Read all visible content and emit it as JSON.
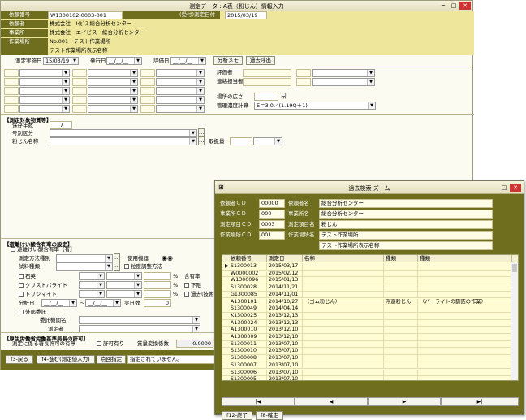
{
  "main": {
    "title": "測定データ : A表（粉じん）情報入力",
    "header": {
      "client_label": "依頼番号",
      "client_no": "W1300102-0003-001",
      "date_label": "(受付)測定日付",
      "date_value": "2015/03/19",
      "requester_label": "依頼者",
      "requester_value": "株式会社　Iｲﾋﾞｽ 総合分析センター",
      "office_label": "事業所",
      "office_value": "株式会社　エイビス　総合分析センター",
      "workplace_label": "作業場所",
      "workplace_value": "No.001　テスト作業場所",
      "workplace_display": "テスト作業場所表示名称"
    },
    "toolbar": {
      "implementation_date_label": "測定実施日",
      "implementation_date": "15/03/19",
      "issue_date_label": "発行日",
      "issue_date": "__/__/__",
      "eval_date_label": "評価日",
      "eval_date": "__/__/__",
      "analysis_memo": "分析メモ",
      "past_call": "過去呼出"
    },
    "middle": {
      "evaluator_label": "評価者",
      "liaison_label": "連絡担当者",
      "area_label": "場所の広さ",
      "area_unit": "㎡",
      "mgmt_label": "管理濃度計算",
      "mgmt_value": "E＝3.0／(1.19Q＋1)"
    },
    "target": {
      "section": "【測定対象物質等】",
      "retention_label": "保存年数",
      "retention_value": "7",
      "category_label": "号別区分",
      "dust_label": "粉じん名称",
      "handling_label": "取扱量"
    },
    "free": {
      "section": "【遊離けい酸含有率の設定】",
      "setting": "遊離けい酸含有率【有】",
      "method_label": "測定方法種別",
      "device_label": "使用機器",
      "sample_label": "試料種類",
      "particle_label": "粒度調整方法",
      "stone": "石英",
      "cristobalite": "クリストバライト",
      "tridymite": "トリジマイト",
      "content_label": "含有率",
      "bottom": "下限",
      "past": "過去(技術)",
      "pct": "%",
      "analysis_date_label": "分析日",
      "analysis_date_from": "__/__/__",
      "analysis_date_to": "__/__/__",
      "days_label": "実日数",
      "days_value": "0",
      "outsource": "外部委託",
      "agency_label": "委託機関名",
      "measurer_label": "測定者"
    },
    "permit": {
      "section": "【厚生労働省労働基準局長の許可】",
      "question": "測定に係る署長許可の有無",
      "allowed": "許可有り",
      "coef_label": "質量変換係数",
      "coef_value": "0.0000"
    },
    "footer": {
      "f3": "f3-戻る",
      "f4": "f4-進む(測定値入力)",
      "check": "点回指定",
      "status": "指定されていません。"
    }
  },
  "popup": {
    "title": "過去検索 ズーム",
    "fields": {
      "client_cd_label": "依頼者ＣＤ",
      "client_cd": "00000",
      "client_name_label": "依頼者名",
      "client_name": "総合分析センター",
      "office_cd_label": "事業所ＣＤ",
      "office_cd": "000",
      "office_name_label": "事業所名",
      "office_name": "総合分析センター",
      "item_cd_label": "測定項目ＣＤ",
      "item_cd": "0003",
      "item_name_label": "測定項目名",
      "item_name": "粉じん",
      "place_cd_label": "作業場所ＣＤ",
      "place_cd": "001",
      "place_name_label": "作業場所名",
      "place_name": "テスト作業場所",
      "place_display": "テスト作業場所表示名称"
    },
    "columns": [
      "依頼番号",
      "測定日",
      "名称",
      "種類",
      "種類"
    ],
    "rows": [
      [
        "S1300013",
        "2015/03/17",
        "",
        "",
        ""
      ],
      [
        "W0000002",
        "2015/02/12",
        "",
        "",
        ""
      ],
      [
        "W1300096",
        "2015/01/13",
        "",
        "",
        ""
      ],
      [
        "S1300028",
        "2014/11/21",
        "",
        "",
        ""
      ],
      [
        "G1300085",
        "2014/11/01",
        "",
        "",
        ""
      ],
      [
        "A1300101",
        "2014/10/27",
        "（ゴム粉じん）",
        "浮遊粉じん",
        "（パーライトの篩詰の作業）"
      ],
      [
        "S1300049",
        "2014/04/14",
        "",
        "",
        ""
      ],
      [
        "K1300025",
        "2013/12/13",
        "",
        "",
        ""
      ],
      [
        "A1300024",
        "2013/12/13",
        "",
        "",
        ""
      ],
      [
        "A1300010",
        "2013/12/10",
        "",
        "",
        ""
      ],
      [
        "A1300009",
        "2013/12/10",
        "",
        "",
        ""
      ],
      [
        "S1300011",
        "2013/07/10",
        "",
        "",
        ""
      ],
      [
        "S1300010",
        "2013/07/10",
        "",
        "",
        ""
      ],
      [
        "S1300008",
        "2013/07/10",
        "",
        "",
        ""
      ],
      [
        "S1300007",
        "2013/07/10",
        "",
        "",
        ""
      ],
      [
        "S1300006",
        "2013/07/10",
        "",
        "",
        ""
      ],
      [
        "S1300005",
        "2013/07/10",
        "",
        "",
        ""
      ]
    ],
    "nav": [
      "|◀",
      "◀",
      "▶",
      "▶|"
    ],
    "f12": "f12-終了",
    "f8": "f8-確定"
  }
}
